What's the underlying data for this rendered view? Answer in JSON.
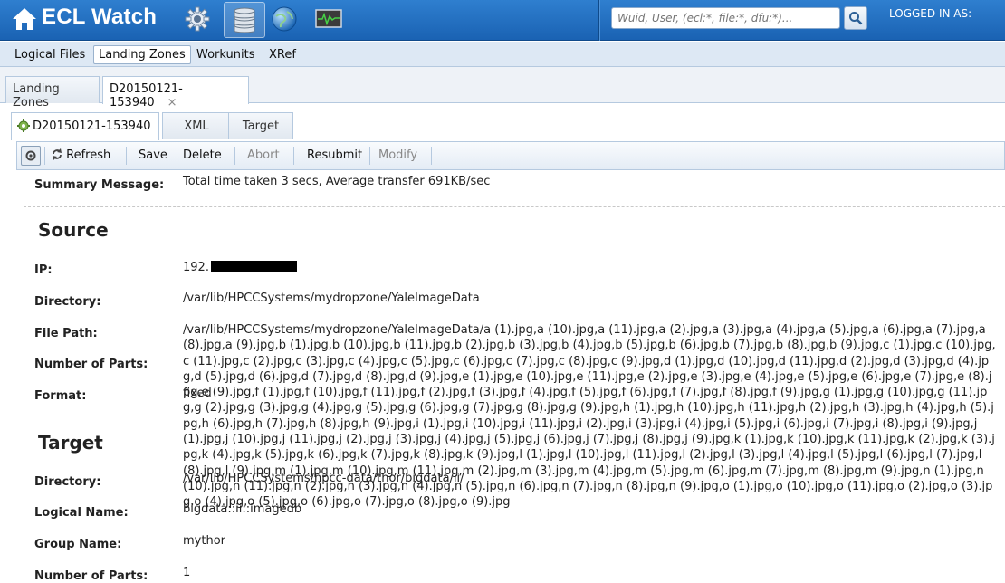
{
  "header": {
    "app_title": "ECL Watch",
    "search_placeholder": "Wuid, User, (ecl:*, file:*, dfu:*)...",
    "logged_in_label": "LOGGED IN AS:",
    "icons": [
      "home-icon",
      "gear-icon",
      "database-icon",
      "globe-icon",
      "monitor-icon",
      "search-icon"
    ],
    "brand_color": "#1f6cc0"
  },
  "mainnav": {
    "items": [
      {
        "label": "Logical Files"
      },
      {
        "label": "Landing Zones",
        "active": true
      },
      {
        "label": "Workunits"
      },
      {
        "label": "XRef"
      }
    ]
  },
  "outer_tabs": [
    {
      "label": "Landing Zones"
    },
    {
      "label": "D20150121-153940",
      "active": true,
      "close": "×"
    }
  ],
  "inner_tabs": [
    {
      "label": "D20150121-153940",
      "active": true,
      "icon": "gear-icon"
    },
    {
      "label": "XML"
    },
    {
      "label": "Target"
    }
  ],
  "toolbar": {
    "refresh": "Refresh",
    "save": "Save",
    "delete": "Delete",
    "abort": "Abort",
    "resubmit": "Resubmit",
    "modify": "Modify"
  },
  "details": {
    "summary_label": "Summary Message:",
    "summary_value": "Total time taken 3 secs, Average transfer 691KB/sec",
    "source_head": "Source",
    "ip_label": "IP:",
    "ip_value": "192.",
    "directory_label": "Directory:",
    "directory_value": "/var/lib/HPCCSystems/mydropzone/YaleImageData",
    "file_path_label": "File Path:",
    "file_path_value": "/var/lib/HPCCSystems/mydropzone/YaleImageData/a (1).jpg,a (10).jpg,a (11).jpg,a (2).jpg,a (3).jpg,a (4).jpg,a (5).jpg,a (6).jpg,a (7).jpg,a (8).jpg,a (9).jpg,b (1).jpg,b (10).jpg,b (11).jpg,b (2).jpg,b (3).jpg,b (4).jpg,b (5).jpg,b (6).jpg,b (7).jpg,b (8).jpg,b (9).jpg,c (1).jpg,c (10).jpg,c (11).jpg,c (2).jpg,c (3).jpg,c (4).jpg,c (5).jpg,c (6).jpg,c (7).jpg,c (8).jpg,c (9).jpg,d (1).jpg,d (10).jpg,d (11).jpg,d (2).jpg,d (3).jpg,d (4).jpg,d (5).jpg,d (6).jpg,d (7).jpg,d (8).jpg,d (9).jpg,e (1).jpg,e (10).jpg,e (11).jpg,e (2).jpg,e (3).jpg,e (4).jpg,e (5).jpg,e (6).jpg,e (7).jpg,e (8).jpg,e (9).jpg,f (1).jpg,f (10).jpg,f (11).jpg,f (2).jpg,f (3).jpg,f (4).jpg,f (5).jpg,f (6).jpg,f (7).jpg,f (8).jpg,f (9).jpg,g (1).jpg,g (10).jpg,g (11).jpg,g (2).jpg,g (3).jpg,g (4).jpg,g (5).jpg,g (6).jpg,g (7).jpg,g (8).jpg,g (9).jpg,h (1).jpg,h (10).jpg,h (11).jpg,h (2).jpg,h (3).jpg,h (4).jpg,h (5).jpg,h (6).jpg,h (7).jpg,h (8).jpg,h (9).jpg,i (1).jpg,i (10).jpg,i (11).jpg,i (2).jpg,i (3).jpg,i (4).jpg,i (5).jpg,i (6).jpg,i (7).jpg,i (8).jpg,i (9).jpg,j (1).jpg,j (10).jpg,j (11).jpg,j (2).jpg,j (3).jpg,j (4).jpg,j (5).jpg,j (6).jpg,j (7).jpg,j (8).jpg,j (9).jpg,k (1).jpg,k (10).jpg,k (11).jpg,k (2).jpg,k (3).jpg,k (4).jpg,k (5).jpg,k (6).jpg,k (7).jpg,k (8).jpg,k (9).jpg,l (1).jpg,l (10).jpg,l (11).jpg,l (2).jpg,l (3).jpg,l (4).jpg,l (5).jpg,l (6).jpg,l (7).jpg,l (8).jpg,l (9).jpg,m (1).jpg,m (10).jpg,m (11).jpg,m (2).jpg,m (3).jpg,m (4).jpg,m (5).jpg,m (6).jpg,m (7).jpg,m (8).jpg,m (9).jpg,n (1).jpg,n (10).jpg,n (11).jpg,n (2).jpg,n (3).jpg,n (4).jpg,n (5).jpg,n (6).jpg,n (7).jpg,n (8).jpg,n (9).jpg,o (1).jpg,o (10).jpg,o (11).jpg,o (2).jpg,o (3).jpg,o (4).jpg,o (5).jpg,o (6).jpg,o (7).jpg,o (8).jpg,o (9).jpg",
    "num_parts_label": "Number of Parts:",
    "format_label": "Format:",
    "format_value": "fixed",
    "target_head": "Target",
    "target_directory_label": "Directory:",
    "target_directory_value": "/var/lib/HPCCSystems/hpcc-data/thor/bigdata/ii/",
    "logical_name_label": "Logical Name:",
    "logical_name_value": "bigdata::ii::imagedb",
    "group_name_label": "Group Name:",
    "group_name_value": "mythor",
    "target_num_parts_label": "Number of Parts:",
    "target_num_parts_value": "1"
  }
}
